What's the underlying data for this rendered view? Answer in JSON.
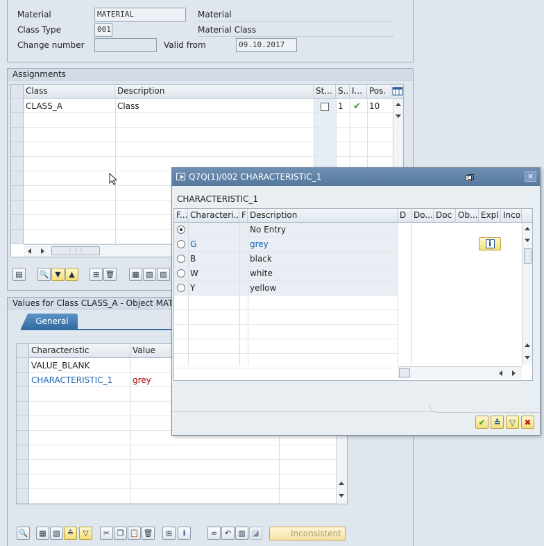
{
  "selection": {
    "material_label": "Material",
    "material_value": "MATERIAL",
    "material_desc_label": "Material",
    "class_type_label": "Class Type",
    "class_type_value": "001",
    "class_type_desc": "Material Class",
    "change_number_label": "Change number",
    "change_number_value": "",
    "valid_from_label": "Valid from",
    "valid_from_value": "09.10.2017"
  },
  "assignments": {
    "title": "Assignments",
    "columns": [
      "Class",
      "Description",
      "St...",
      "S...",
      "I...",
      "Pos."
    ],
    "rows": [
      {
        "class": "CLASS_A",
        "description": "Class",
        "s": "1",
        "pos": "10"
      }
    ]
  },
  "values": {
    "title": "Values for Class CLASS_A - Object MATER",
    "tab_general": "General",
    "columns": [
      "Characteristic",
      "Value"
    ],
    "rows": [
      {
        "characteristic": "VALUE_BLANK",
        "value": ""
      },
      {
        "characteristic": "CHARACTERISTIC_1",
        "value": "grey"
      }
    ],
    "inconsistent_label": "Inconsistent"
  },
  "popup": {
    "title": "Q7Q(1)/002 CHARACTERISTIC_1",
    "subtitle": "CHARACTERISTIC_1",
    "columns": [
      "F...",
      "Characteri...",
      "F",
      "Description",
      "D",
      "Do...",
      "Doc",
      "Ob...",
      "Expl",
      "Inco"
    ],
    "rows": [
      {
        "code": "",
        "description": "No Entry",
        "selected": true
      },
      {
        "code": "G",
        "description": "grey",
        "selected": false
      },
      {
        "code": "B",
        "description": "black",
        "selected": false
      },
      {
        "code": "W",
        "description": "white",
        "selected": false
      },
      {
        "code": "Y",
        "description": "yellow",
        "selected": false
      }
    ],
    "info_icon": "info-icon"
  },
  "colors": {
    "link_blue": "#1a65b0",
    "value_red": "#b00000",
    "title_bar": "#5f82a8"
  }
}
